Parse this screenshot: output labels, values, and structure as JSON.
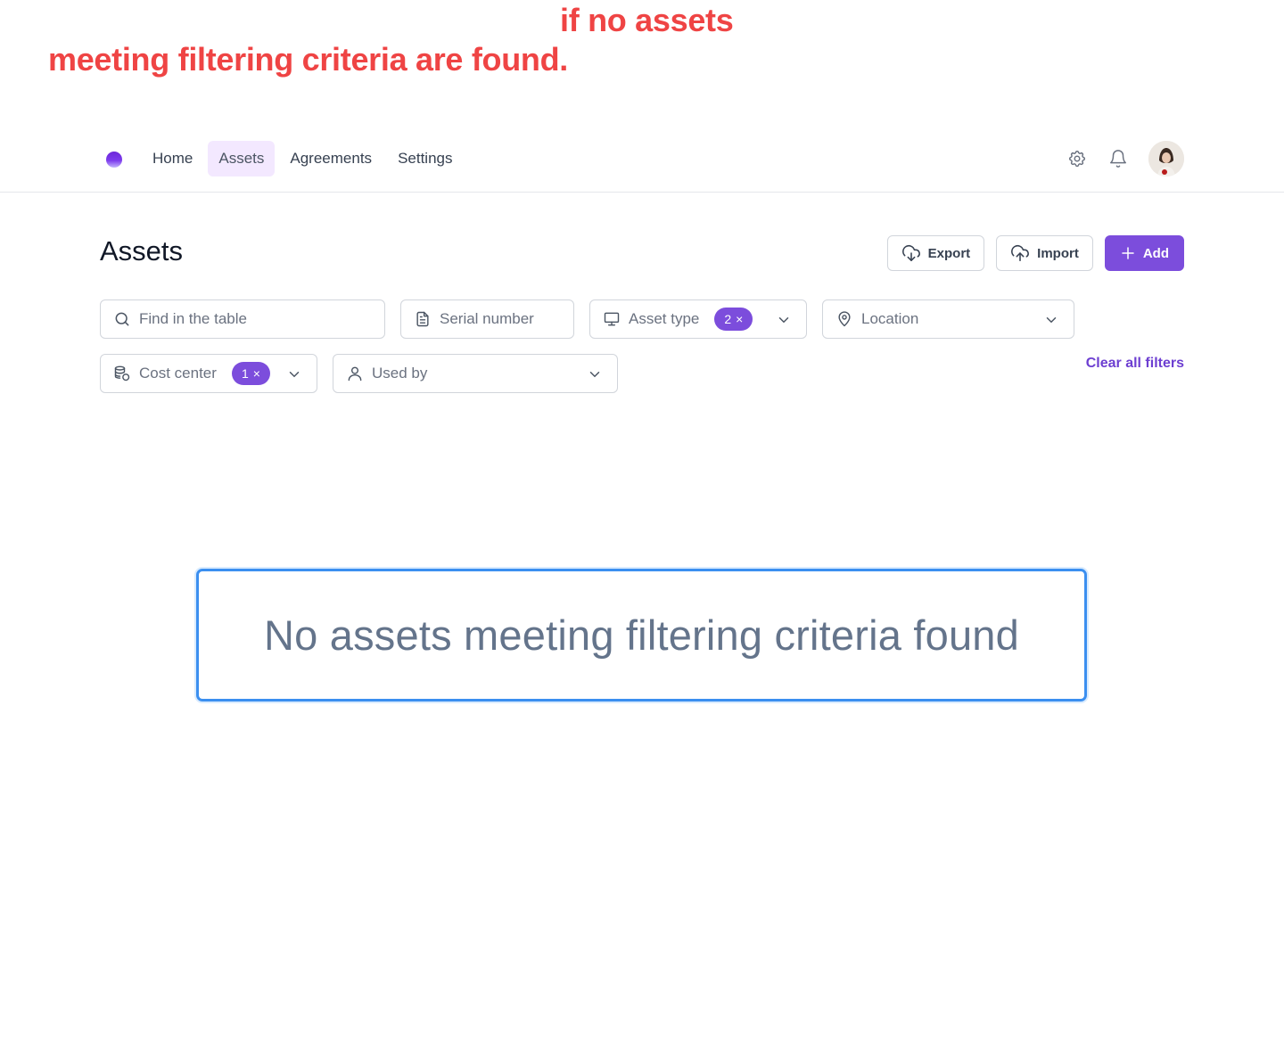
{
  "annotation": {
    "line1": "if no assets",
    "line2": "meeting filtering criteria are found."
  },
  "nav": {
    "items": [
      {
        "label": "Home"
      },
      {
        "label": "Assets",
        "active": true
      },
      {
        "label": "Agreements"
      },
      {
        "label": "Settings"
      }
    ]
  },
  "header_icons": [
    "gear-icon",
    "bell-icon",
    "avatar"
  ],
  "page": {
    "title": "Assets"
  },
  "actions": {
    "export_label": "Export",
    "import_label": "Import",
    "add_label": "Add"
  },
  "filters": {
    "search_placeholder": "Find in the table",
    "serial_placeholder": "Serial number",
    "asset_type_label": "Asset type",
    "asset_type_count": "2",
    "location_label": "Location",
    "cost_center_label": "Cost center",
    "cost_center_count": "1",
    "used_by_label": "Used by",
    "clear_all_label": "Clear all filters"
  },
  "empty_state": {
    "message": "No assets meeting filtering criteria found"
  },
  "colors": {
    "primary": "#7c4ddc",
    "annotation": "#ef4444",
    "focus_border": "#3b8ff0",
    "active_nav_bg": "#f3e8ff"
  }
}
